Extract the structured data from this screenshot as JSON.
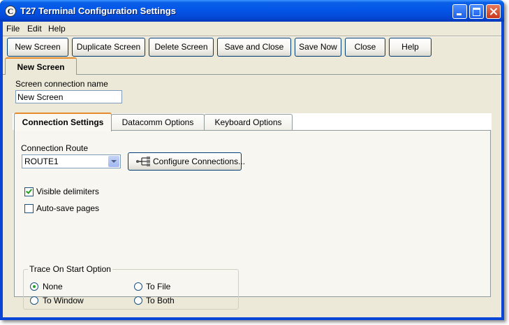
{
  "window": {
    "title": "T27 Terminal Configuration Settings",
    "app_icon": "C"
  },
  "menu": [
    {
      "label": "File"
    },
    {
      "label": "Edit"
    },
    {
      "label": "Help"
    }
  ],
  "toolbar": [
    {
      "label": "New Screen"
    },
    {
      "label": "Duplicate Screen"
    },
    {
      "label": "Delete Screen"
    },
    {
      "label": "Save and Close"
    },
    {
      "label": "Save Now"
    },
    {
      "label": "Close"
    },
    {
      "label": "Help"
    }
  ],
  "document_tab": {
    "label": "New Screen"
  },
  "screen_name": {
    "label": "Screen connection name",
    "value": "New Screen"
  },
  "tabs": [
    {
      "label": "Connection Settings",
      "active": true
    },
    {
      "label": "Datacomm Options",
      "active": false
    },
    {
      "label": "Keyboard Options",
      "active": false
    }
  ],
  "connection": {
    "route_label": "Connection Route",
    "route_value": "ROUTE1",
    "configure_label": "Configure Connections...",
    "configure_icon": "network-icon"
  },
  "checkboxes": [
    {
      "label": "Visible delimiters",
      "checked": true
    },
    {
      "label": "Auto-save pages",
      "checked": false
    }
  ],
  "trace": {
    "title": "Trace On Start Option",
    "options": [
      {
        "label": "None",
        "selected": true
      },
      {
        "label": "To File",
        "selected": false
      },
      {
        "label": "To Window",
        "selected": false
      },
      {
        "label": "To Both",
        "selected": false
      }
    ]
  },
  "colors": {
    "title_bar": "#0356e8",
    "face": "#ece9d8",
    "active_tab_accent": "#e68b2c",
    "check": "#21a121"
  }
}
